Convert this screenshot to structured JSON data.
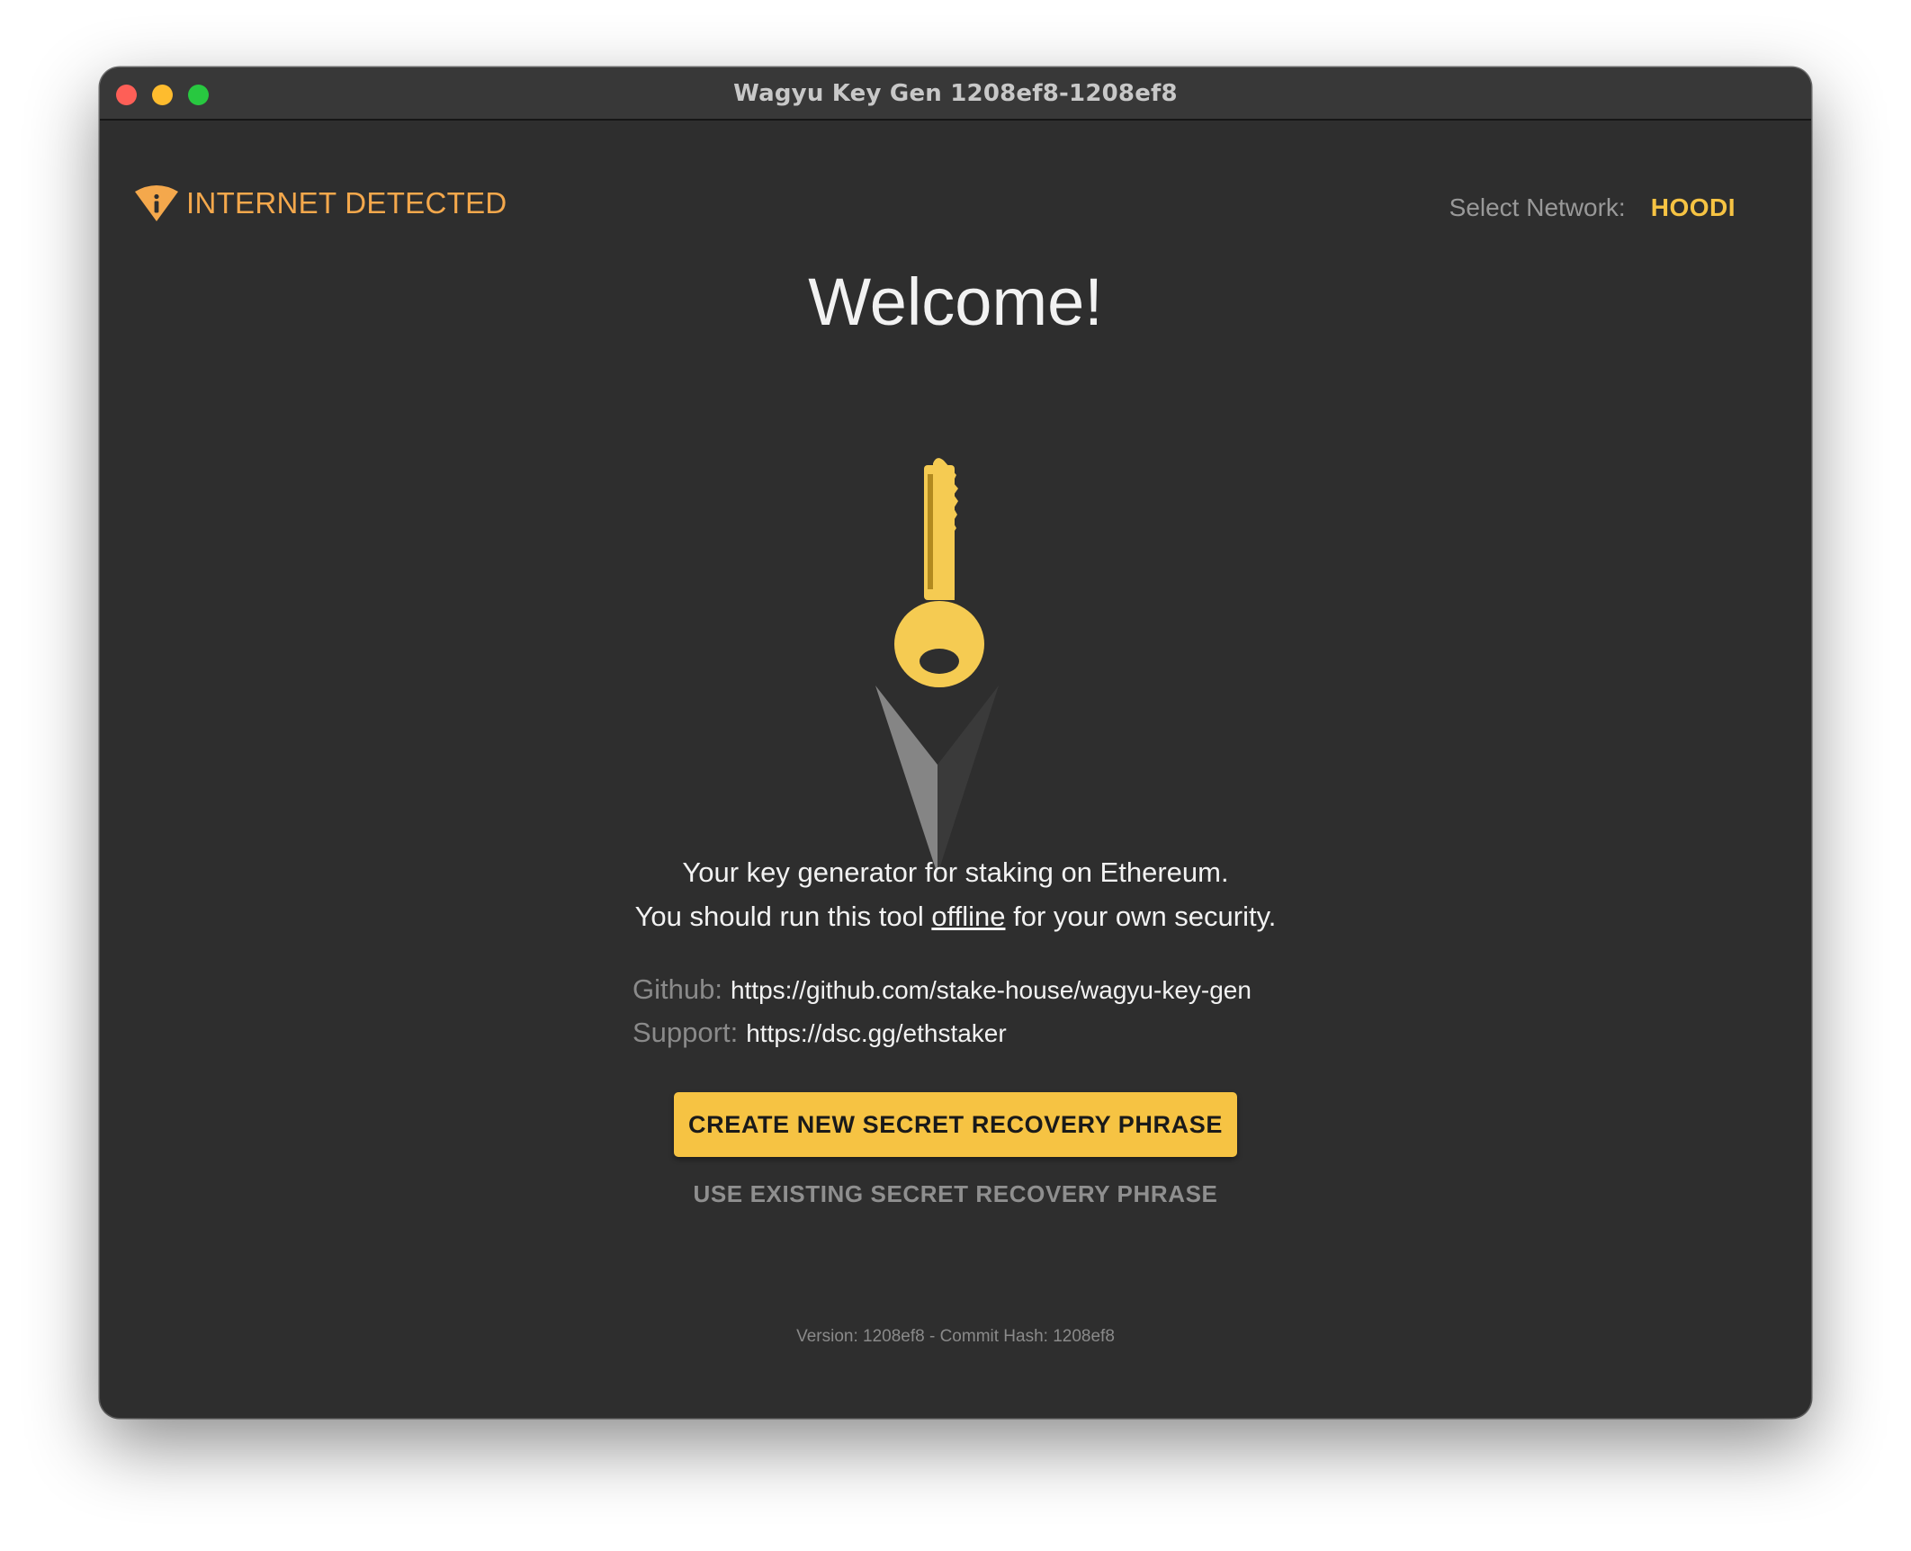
{
  "window": {
    "title": "Wagyu Key Gen 1208ef8-1208ef8"
  },
  "status": {
    "internet_warning": "INTERNET DETECTED",
    "warning_icon": "wifi-info-icon",
    "warning_color": "#f4a84c"
  },
  "network": {
    "label": "Select Network:",
    "value": "HOODI",
    "value_color": "#f6c343"
  },
  "main": {
    "heading": "Welcome!",
    "logo": "key-icon",
    "tagline_line1": "Your key generator for staking on Ethereum.",
    "tagline_line2_before": "You should run this tool ",
    "tagline_line2_emphasis": "offline",
    "tagline_line2_after": " for your own security.",
    "github_label": "Github:",
    "github_url": "https://github.com/stake-house/wagyu-key-gen",
    "support_label": "Support:",
    "support_url": "https://dsc.gg/ethstaker",
    "create_button": "CREATE NEW SECRET RECOVERY PHRASE",
    "existing_button": "USE EXISTING SECRET RECOVERY PHRASE",
    "accent_color": "#f6c343"
  },
  "footer": {
    "version": "Version: 1208ef8 - Commit Hash: 1208ef8"
  }
}
